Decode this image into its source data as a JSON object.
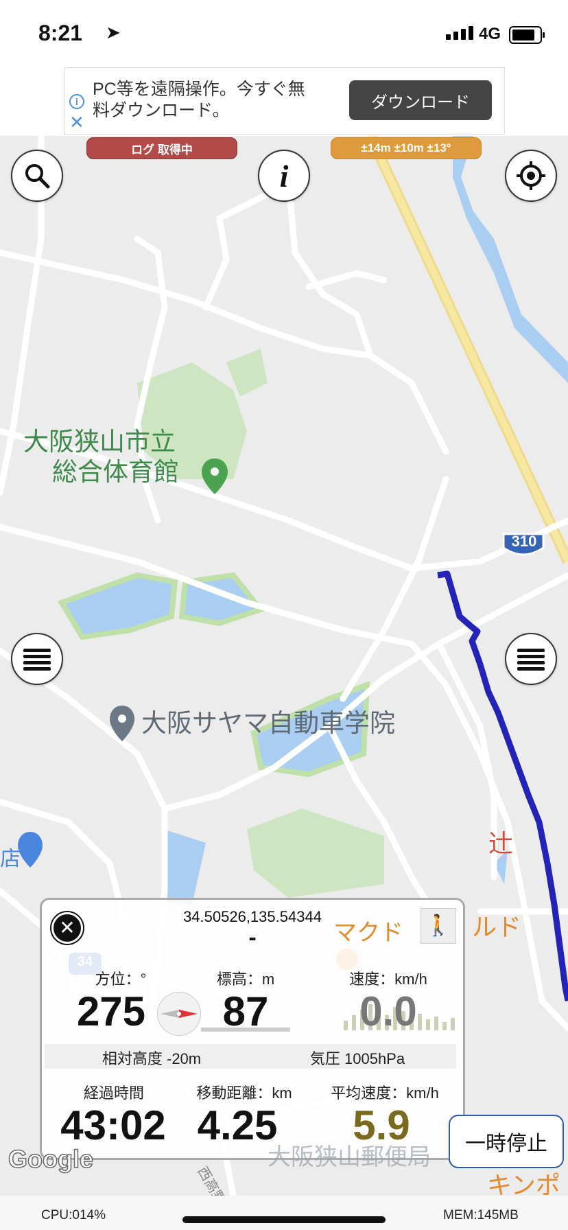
{
  "status_bar": {
    "time": "8:21",
    "network": "4G"
  },
  "ad": {
    "text": "PC等を遠隔操作。今すぐ無料ダウンロード。",
    "button": "ダウンロード"
  },
  "map": {
    "log_status": "ログ 取得中",
    "accuracy": "±14m ±10m ±13°",
    "pois": {
      "gym_line1": "大阪狭山市立",
      "gym_line2": "総合体育館",
      "driving_school": "大阪サヤマ自動車学院",
      "route_number": "310",
      "road_badge": "34",
      "mcd_partial": "マクド",
      "mcd_suffix": "ルド",
      "post_office": "大阪狭山郵便局",
      "right_edge_char": "辻",
      "left_edge_char": "店",
      "kinpo_partial": "キンポ",
      "road_text": "西高野"
    },
    "google_logo": "Google"
  },
  "panel": {
    "coords": "34.50526,135.54344",
    "address": "-",
    "heading_label": "方位：°",
    "heading_value": "275",
    "altitude_label": "標高：m",
    "altitude_value": "87",
    "speed_label": "速度：km/h",
    "speed_value": "0.0",
    "relative_altitude": "相対高度 -20m",
    "pressure": "気圧 1005hPa",
    "elapsed_label": "経過時間",
    "elapsed_value": "43:02",
    "distance_label": "移動距離：km",
    "distance_value": "4.25",
    "avg_speed_label": "平均速度：km/h",
    "avg_speed_value": "5.9"
  },
  "pause_button": "一時停止",
  "bottom": {
    "cpu": "CPU:014%",
    "mem": "MEM:145MB"
  },
  "colors": {
    "route": "#2323b8",
    "highway": "#f6e7a1",
    "water": "#aacdf2",
    "park": "#cde5c0",
    "log_pill": "#b34a4a",
    "accuracy_pill": "#e09a3e",
    "avg_speed": "#7a6a1e"
  }
}
